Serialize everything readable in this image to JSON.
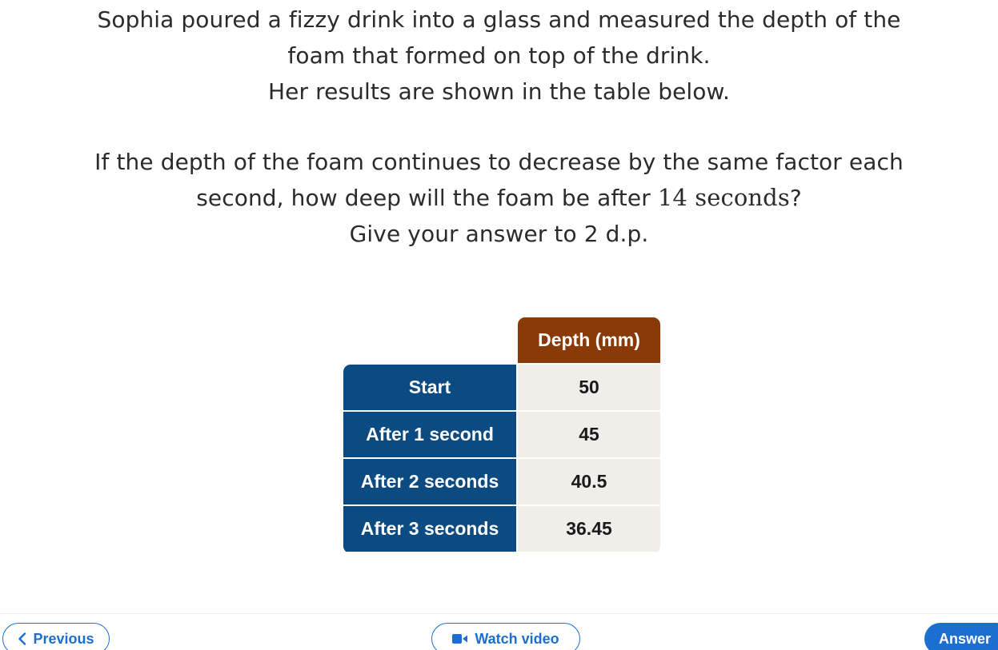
{
  "question": {
    "para1": [
      "Sophia poured a fizzy drink into a glass and measured the depth of the",
      "foam that formed on top of the drink.",
      "Her results are shown in the table below."
    ],
    "para2_line1": "If the depth of the foam continues to decrease by the same factor each",
    "para2_line2_prefix": "second, how deep will the foam be after ",
    "para2_line2_math": "14 seconds",
    "para2_line2_suffix": "?",
    "para2_line3": "Give your answer to 2 d.p."
  },
  "table": {
    "header": "Depth (mm)",
    "rows": [
      {
        "label": "Start",
        "value": "50"
      },
      {
        "label": "After 1 second",
        "value": "45"
      },
      {
        "label": "After 2 seconds",
        "value": "40.5"
      },
      {
        "label": "After 3 seconds",
        "value": "36.45"
      }
    ],
    "colors": {
      "header_bg": "#8a3a07",
      "label_bg": "#0c4a82",
      "value_bg": "#f1eeea"
    }
  },
  "nav": {
    "previous_label": "Previous",
    "previous_icon": "chevron-left-icon",
    "video_label": "Watch video",
    "video_icon": "video-camera-icon",
    "answer_label": "Answer",
    "accent_color": "#1b6fd1"
  }
}
